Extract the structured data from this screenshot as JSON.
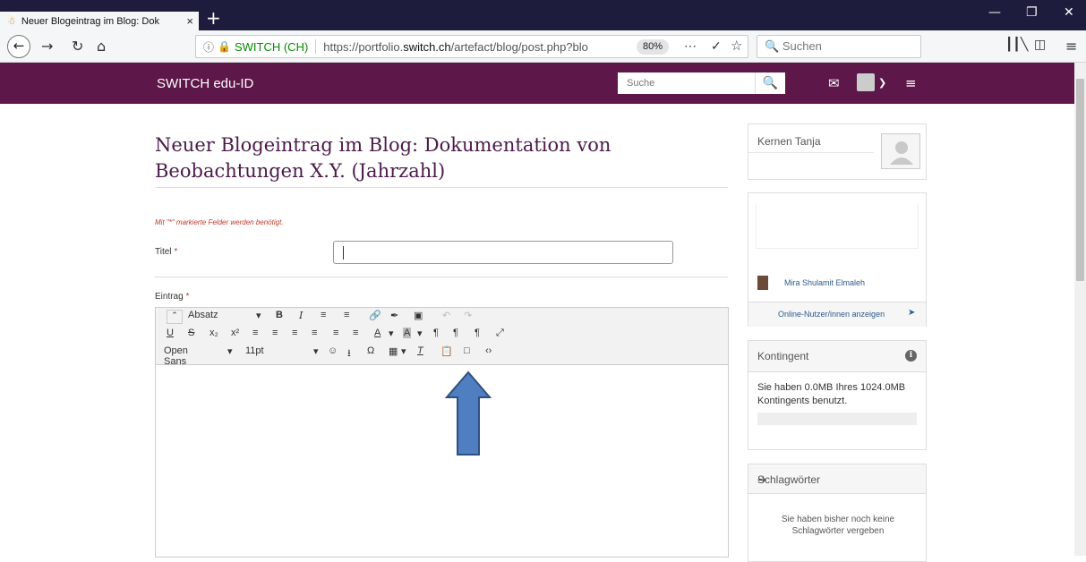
{
  "browser": {
    "tab_title": "Neuer Blogeintrag im Blog: Dok",
    "tab_close": "×",
    "new_tab": "+",
    "url_site": "SWITCH (CH)",
    "url_prefix": "https://portfolio.",
    "url_domain": "switch.ch",
    "url_path": "/artefact/blog/post.php?blo",
    "zoom": "80%",
    "search_placeholder": "Suchen"
  },
  "site": {
    "brand": "SWITCH edu-ID",
    "search_placeholder": "Suche"
  },
  "page": {
    "title": "Neuer Blogeintrag im Blog: Dokumentation von Beobachtungen X.Y. (Jahrzahl)",
    "required_note": "Mit \"*\" markierte Felder werden benötigt.",
    "titel_label": "Titel",
    "eintrag_label": "Eintrag",
    "required_marker": "*",
    "titel_value": ""
  },
  "editor": {
    "format_select": "Absatz",
    "font_select": "Open Sans",
    "size_select": "11pt"
  },
  "sidebar": {
    "profile_name": "Kernen Tanja",
    "online_user": "Mira Shulamit Elmaleh",
    "online_link": "Online-Nutzer/innen anzeigen",
    "quota_title": "Kontingent",
    "quota_text": "Sie haben 0.0MB Ihres 1024.0MB Kontingents benutzt.",
    "quota_used_fraction": 0.0,
    "tags_title": "Schlagwörter",
    "tags_text": "Sie haben bisher noch keine Schlagwörter vergeben"
  },
  "colors": {
    "header_bg": "#5d1749",
    "title_color": "#4b1a4a",
    "tabbar_bg": "#1d1c3d",
    "arrow_fill": "#4f7fc0",
    "link": "#2c5a8c"
  }
}
